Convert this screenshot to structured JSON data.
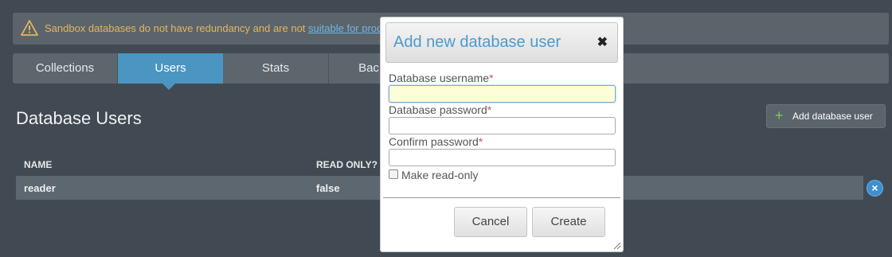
{
  "banner": {
    "message_prefix": "Sandbox databases do not have redundancy and are not ",
    "link_text": "suitable for produ",
    "warning_color": "#e5b55c"
  },
  "tabs": [
    {
      "label": "Collections"
    },
    {
      "label": "Users",
      "active": true
    },
    {
      "label": "Stats"
    },
    {
      "label": "Bac"
    }
  ],
  "page": {
    "title": "Database Users",
    "add_user_label": "Add database user"
  },
  "table": {
    "headers": [
      "NAME",
      "READ ONLY?"
    ],
    "rows": [
      {
        "name": "reader",
        "read_only": "false"
      }
    ]
  },
  "modal": {
    "title": "Add new database user",
    "close_glyph": "✖",
    "fields": [
      {
        "label": "Database username",
        "required_mark": "*",
        "value": ""
      },
      {
        "label": "Database password",
        "required_mark": "*",
        "value": ""
      },
      {
        "label": "Confirm password",
        "required_mark": "*",
        "value": ""
      }
    ],
    "checkbox_label": "Make read-only",
    "cancel_label": "Cancel",
    "create_label": "Create"
  },
  "colors": {
    "accent": "#4a95c1",
    "background": "#414a53",
    "required": "#d9534f"
  }
}
